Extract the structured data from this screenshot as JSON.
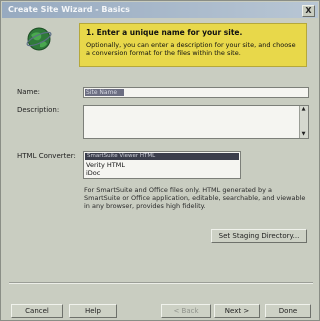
{
  "window": {
    "title": "Create Site Wizard - Basics",
    "close_glyph": "X"
  },
  "banner": {
    "title": "1. Enter a unique name for your site.",
    "text": "Optionally, you can enter a description for your site, and choose a conversion format for the files within the site."
  },
  "form": {
    "name_label": "Name:",
    "name_value": "Site Name",
    "description_label": "Description:",
    "description_value": "",
    "converter_label": "HTML Converter:",
    "converter_options": [
      "SmartSuite Viewer HTML",
      "Verity HTML",
      "iDoc"
    ],
    "converter_selected_index": 0,
    "info_text": "For SmartSuite and Office files only. HTML generated by a SmartSuite or Office application, editable, searchable, and viewable in any browser, provides high fidelity."
  },
  "buttons": {
    "staging": "Set Staging Directory...",
    "cancel": "Cancel",
    "help": "Help",
    "back": "< Back",
    "next": "Next >",
    "done": "Done"
  },
  "colors": {
    "banner": "#e8d84a",
    "titlebar": "#97aac0",
    "selection": "#3b3e4c"
  },
  "icons": {
    "wizard": "globe-icon"
  }
}
